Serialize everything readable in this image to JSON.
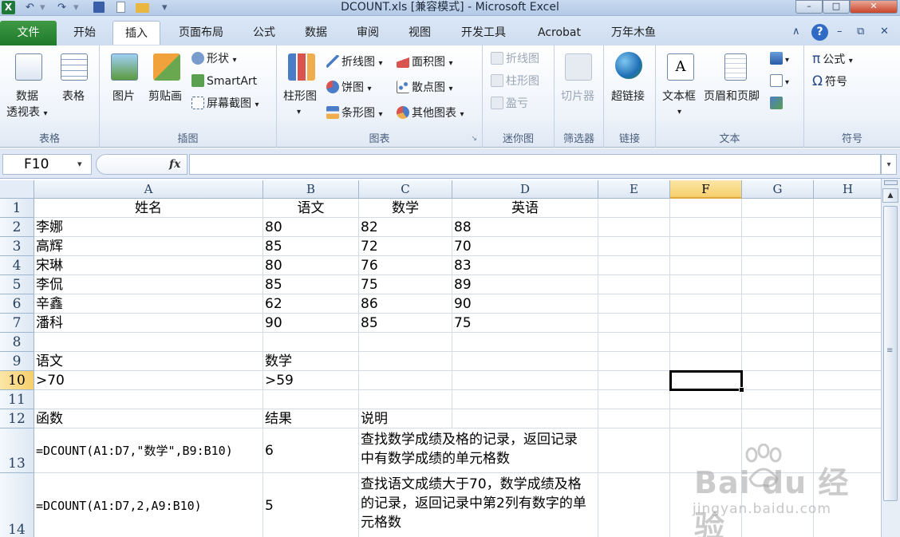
{
  "window": {
    "title": "DCOUNT.xls  [兼容模式] - Microsoft Excel",
    "minimize": "–",
    "restore": "□",
    "close": "✕"
  },
  "qat": {
    "undo": "↶",
    "redo": "↷",
    "separator": "▾"
  },
  "tabs": [
    "文件",
    "开始",
    "插入",
    "页面布局",
    "公式",
    "数据",
    "审阅",
    "视图",
    "开发工具",
    "Acrobat",
    "万年木鱼"
  ],
  "active_tab": "插入",
  "tab_tools": {
    "collapse": "∧",
    "help": "?",
    "restore": "⧉",
    "close": "✕"
  },
  "ribbon": {
    "groups": {
      "table": {
        "label": "表格",
        "pivot_line1": "数据",
        "pivot_line2": "透视表",
        "table": "表格"
      },
      "illustrations": {
        "label": "插图",
        "picture": "图片",
        "clipart": "剪贴画",
        "shapes": "形状",
        "smartart": "SmartArt",
        "screenshot": "屏幕截图"
      },
      "charts": {
        "label": "图表",
        "column": "柱形图",
        "line": "折线图",
        "pie": "饼图",
        "bar": "条形图",
        "area": "面积图",
        "scatter": "散点图",
        "other": "其他图表"
      },
      "sparklines": {
        "label": "迷你图",
        "line": "折线图",
        "column": "柱形图",
        "winloss": "盈亏"
      },
      "filter": {
        "label": "筛选器",
        "slicer": "切片器"
      },
      "links": {
        "label": "链接",
        "hyperlink": "超链接"
      },
      "text": {
        "label": "文本",
        "textbox": "文本框",
        "header_footer": "页眉和页脚"
      },
      "symbols": {
        "label": "符号",
        "equation": "公式",
        "symbol": "符号",
        "pi": "π",
        "omega": "Ω"
      }
    },
    "dropdown_arrow": "▾"
  },
  "formula_bar": {
    "name_box": "F10",
    "fx": "fx",
    "formula": ""
  },
  "sheet": {
    "columns": [
      "A",
      "B",
      "C",
      "D",
      "E",
      "F",
      "G",
      "H"
    ],
    "rows": [
      "1",
      "2",
      "3",
      "4",
      "5",
      "6",
      "7",
      "8",
      "9",
      "10",
      "11",
      "12",
      "13",
      "14"
    ],
    "selected_cell": "F10",
    "cells": {
      "A1": "姓名",
      "B1": "语文",
      "C1": "数学",
      "D1": "英语",
      "A2": "李娜",
      "B2": "80",
      "C2": "82",
      "D2": "88",
      "A3": "高辉",
      "B3": "85",
      "C3": "72",
      "D3": "70",
      "A4": "宋琳",
      "B4": "80",
      "C4": "76",
      "D4": "83",
      "A5": "李侃",
      "B5": "85",
      "C5": "75",
      "D5": "89",
      "A6": "辛鑫",
      "B6": "62",
      "C6": "86",
      "D6": "90",
      "A7": "潘科",
      "B7": "90",
      "C7": "85",
      "D7": "75",
      "A9": "语文",
      "B9": "数学",
      "A10": ">70",
      "B10": ">59",
      "A12": "函数",
      "B12": "结果",
      "C12": "说明",
      "A13": "=DCOUNT(A1:D7,\"数学\",B9:B10)",
      "B13": "6",
      "C13": "查找数学成绩及格的记录，返回记录中有数学成绩的单元格数",
      "A14": "=DCOUNT(A1:D7,2,A9:B10)",
      "B14": "5",
      "C14": "查找语文成绩大于70，数学成绩及格的记录，返回记录中第2列有数字的单元格数"
    }
  },
  "watermark": {
    "brand": "Bai du 经验",
    "url": "jingyan.baidu.com"
  }
}
